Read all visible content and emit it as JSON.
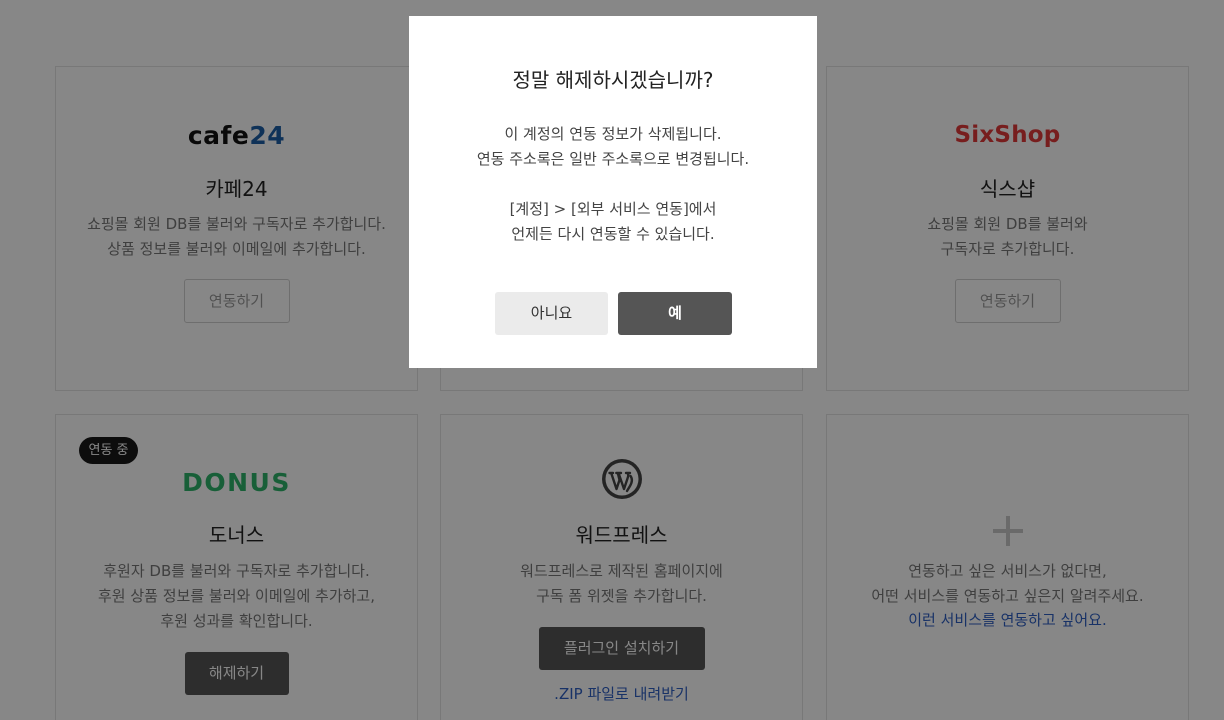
{
  "cards": {
    "cafe24": {
      "logo_part1": "cafe",
      "logo_part2": "24",
      "name": "카페24",
      "desc_line1": "쇼핑몰 회원 DB를 불러와 구독자로 추가합니다.",
      "desc_line2": "상품 정보를 불러와 이메일에 추가합니다.",
      "button": "연동하기"
    },
    "sixshop": {
      "logo": "SixShop",
      "name": "식스샵",
      "desc_line1": "쇼핑몰 회원 DB를 불러와",
      "desc_line2": "구독자로 추가합니다.",
      "button": "연동하기"
    },
    "donus": {
      "badge": "연동 중",
      "logo": "DONUS",
      "name": "도너스",
      "desc_line1": "후원자 DB를 불러와 구독자로 추가합니다.",
      "desc_line2": "후원 상품 정보를 불러와 이메일에 추가하고,",
      "desc_line3": "후원 성과를 확인합니다.",
      "button": "해제하기"
    },
    "wordpress": {
      "name": "워드프레스",
      "desc_line1": "워드프레스로 제작된 홈페이지에",
      "desc_line2": "구독 폼 위젯을 추가합니다.",
      "button": "플러그인 설치하기",
      "link": ".ZIP 파일로 내려받기"
    },
    "request": {
      "desc_line1": "연동하고 싶은 서비스가 없다면,",
      "desc_line2": "어떤 서비스를 연동하고 싶은지 알려주세요.",
      "link": "이런 서비스를 연동하고 싶어요."
    }
  },
  "modal": {
    "title": "정말 해제하시겠습니까?",
    "msg_line1": "이 계정의 연동 정보가 삭제됩니다.",
    "msg_line2": "연동 주소록은 일반 주소록으로 변경됩니다.",
    "msg_line3": "[계정] > [외부 서비스 연동]에서",
    "msg_line4": "언제든 다시 연동할 수 있습니다.",
    "no_label": "아니요",
    "yes_label": "예"
  },
  "colors": {
    "overlay": "#000000",
    "brand_cafe24_blue": "#1d5fa6",
    "brand_sixshop_red": "#e03a3a",
    "brand_donus_green": "#2fb36b",
    "link_blue": "#2f5fc2",
    "dark_button": "#555555"
  }
}
